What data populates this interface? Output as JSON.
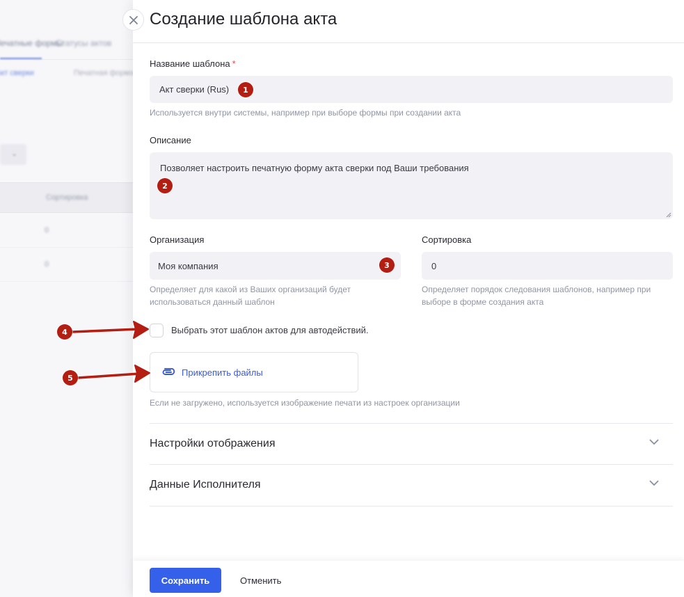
{
  "background": {
    "tabs": [
      "Печатные формы",
      "Статусы актов"
    ],
    "subtabs": [
      "Акт сверки",
      "Печатная форма"
    ],
    "sort_header": "Сортировка",
    "rows": [
      "0",
      "0"
    ]
  },
  "drawer": {
    "title": "Создание шаблона акта",
    "close_icon": "close-icon",
    "template_name": {
      "label": "Название шаблона",
      "required_mark": "*",
      "value": "Акт сверки (Rus)",
      "hint": "Используется внутри системы, например при выборе формы при создании акта"
    },
    "description": {
      "label": "Описание",
      "value": "Позволяет настроить печатную форму акта сверки под Ваши требования"
    },
    "organization": {
      "label": "Организация",
      "value": "Моя компания",
      "hint_line1": "Определяет для какой из Ваших организаций будет",
      "hint_line2": "использоваться данный шаблон"
    },
    "sorting": {
      "label": "Сортировка",
      "value": "0",
      "hint_line1": "Определяет порядок следования шаблонов, например при",
      "hint_line2": "выборе в форме создания акта"
    },
    "auto_actions_checkbox": {
      "label": "Выбрать этот шаблон актов для автодействий.",
      "checked": false
    },
    "attach": {
      "icon": "paperclip-icon",
      "label": "Прикрепить файлы",
      "hint": "Если не загружено, используется изображение печати из настроек организации"
    },
    "sections": [
      {
        "title": "Настройки отображения",
        "expanded": false
      },
      {
        "title": "Данные Исполнителя",
        "expanded": false
      }
    ],
    "footer": {
      "save_label": "Сохранить",
      "cancel_label": "Отменить"
    }
  },
  "annotations": [
    "1",
    "2",
    "3",
    "4",
    "5"
  ],
  "colors": {
    "accent": "#3561ea",
    "link": "#3a5bd4",
    "required": "#e2474b",
    "annotation": "#b31d12",
    "field_bg": "#f1f1f6"
  }
}
